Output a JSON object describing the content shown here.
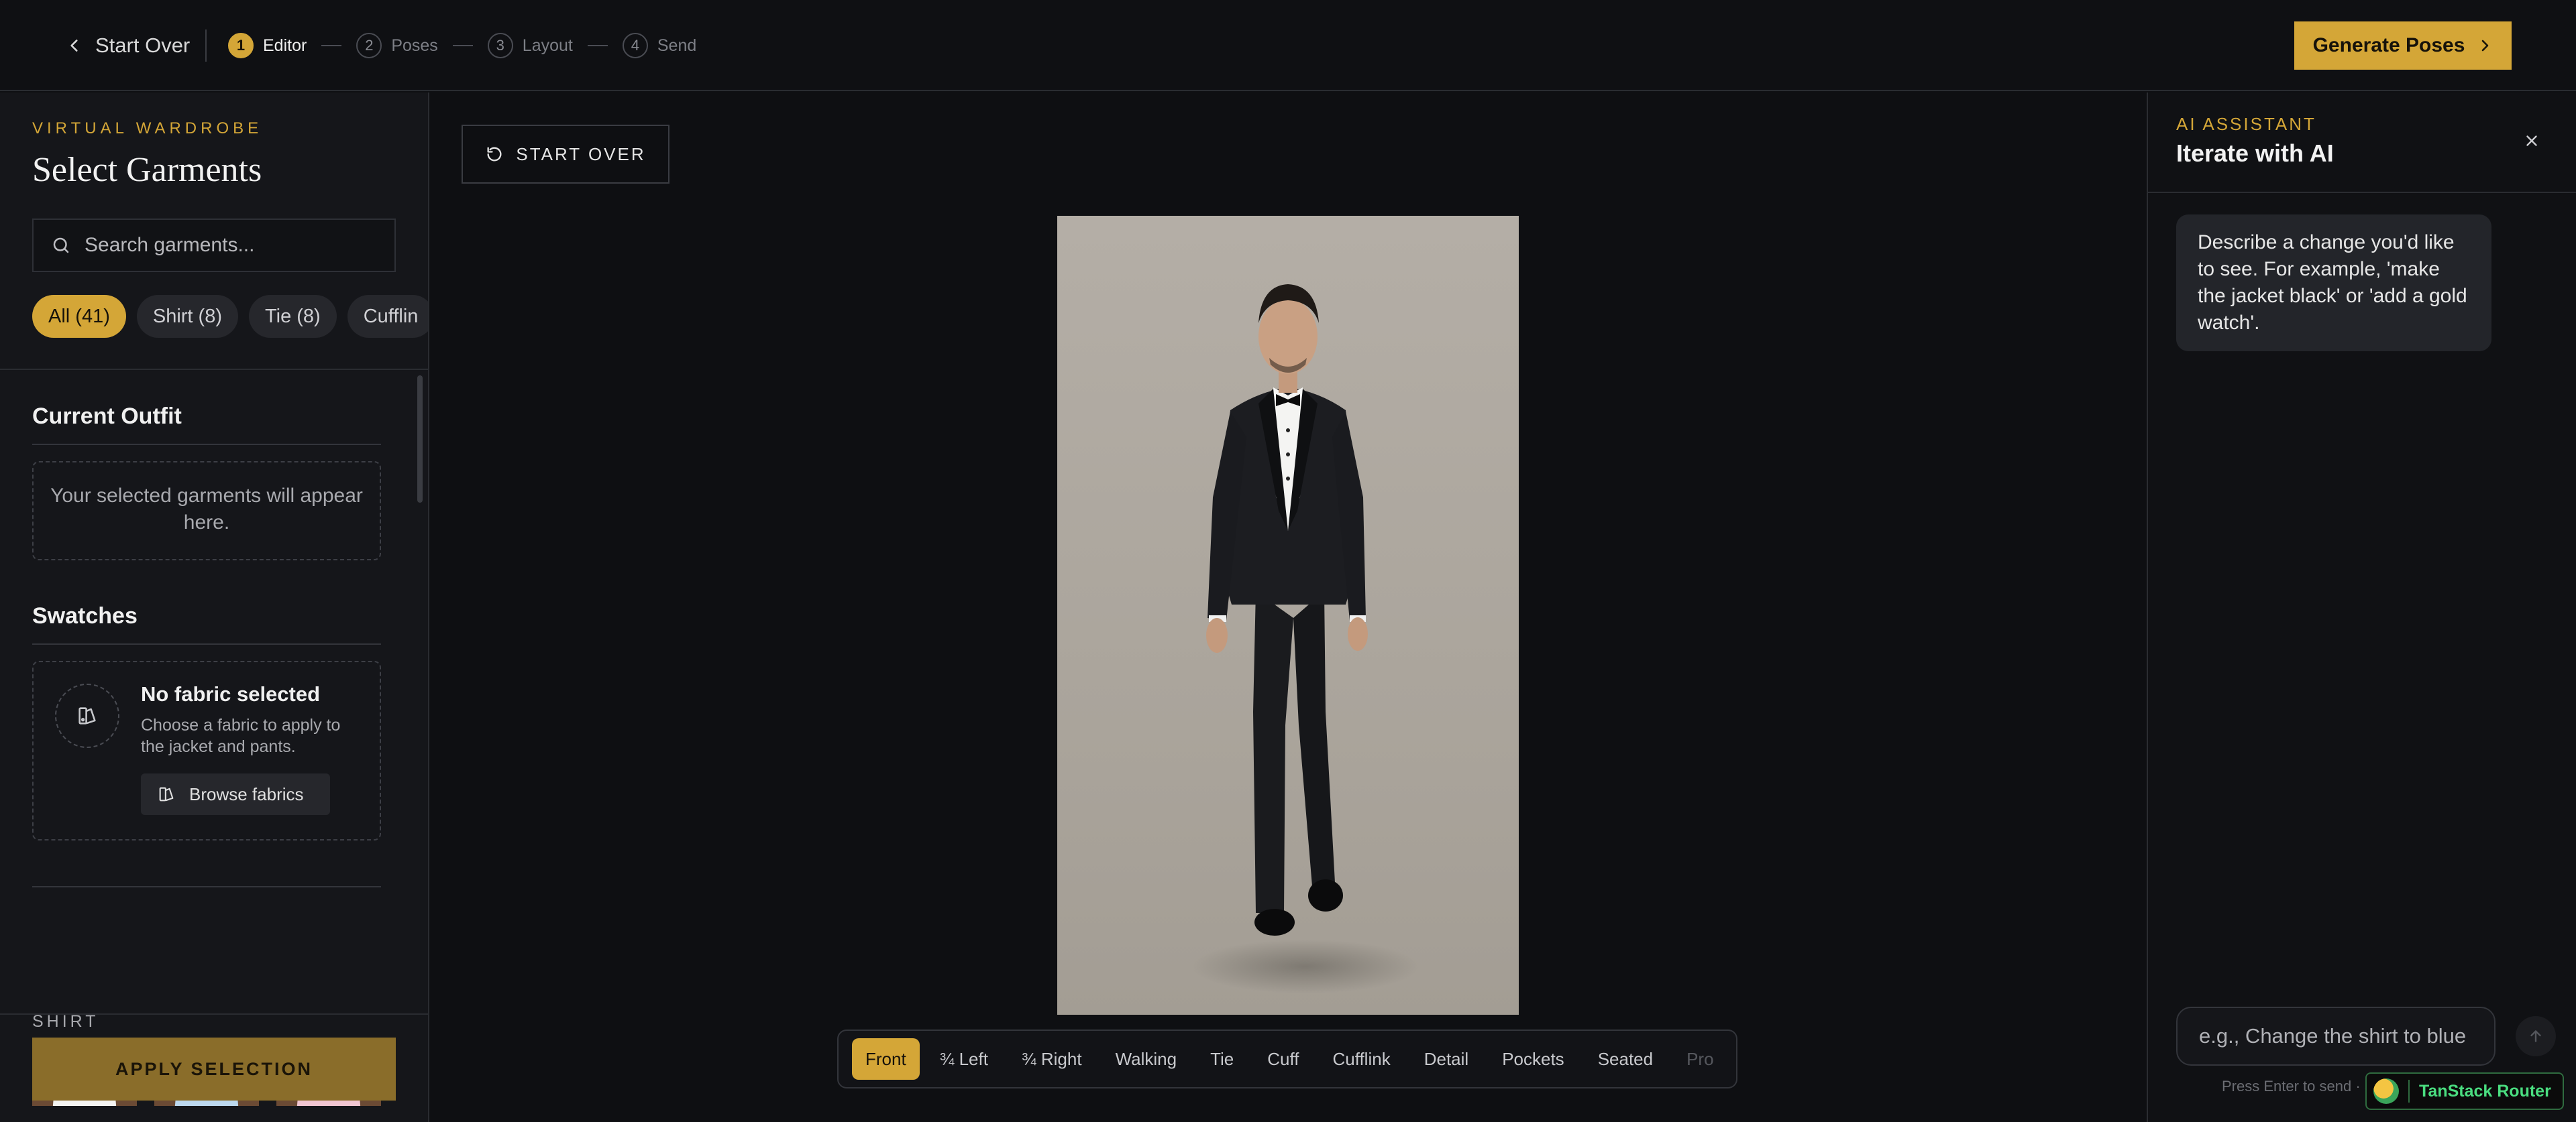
{
  "topbar": {
    "start_over": "Start Over",
    "steps": [
      {
        "num": "1",
        "label": "Editor"
      },
      {
        "num": "2",
        "label": "Poses"
      },
      {
        "num": "3",
        "label": "Layout"
      },
      {
        "num": "4",
        "label": "Send"
      }
    ],
    "active_step": 1,
    "generate_label": "Generate Poses"
  },
  "left": {
    "eyebrow": "VIRTUAL WARDROBE",
    "title": "Select Garments",
    "search_placeholder": "Search garments...",
    "chips": [
      "All (41)",
      "Shirt (8)",
      "Tie (8)",
      "Cufflin"
    ],
    "current_outfit": {
      "title": "Current Outfit",
      "empty_text": "Your selected garments will appear here."
    },
    "swatches": {
      "title": "Swatches",
      "fabric_title": "No fabric selected",
      "fabric_desc": "Choose a fabric to apply to the jacket and pants.",
      "browse_label": "Browse fabrics"
    },
    "shirt_section": "SHIRT",
    "apply_label": "APPLY SELECTION"
  },
  "center": {
    "start_over": "START OVER",
    "poses": [
      "Front",
      "¾ Left",
      "¾ Right",
      "Walking",
      "Tie",
      "Cuff",
      "Cufflink",
      "Detail",
      "Pockets",
      "Seated",
      "Pro"
    ],
    "active_pose": "Front"
  },
  "assistant": {
    "eyebrow": "AI ASSISTANT",
    "title": "Iterate with AI",
    "message": "Describe a change you'd like to see. For example, 'make the jacket black' or 'add a gold watch'.",
    "input_placeholder": "e.g., Change the shirt to blue",
    "hint": "Press Enter to send · Sh"
  },
  "devtools": {
    "label": "TanStack Router"
  },
  "colors": {
    "accent": "#d4a637",
    "background": "#0e0f12",
    "panel": "#15161a"
  }
}
